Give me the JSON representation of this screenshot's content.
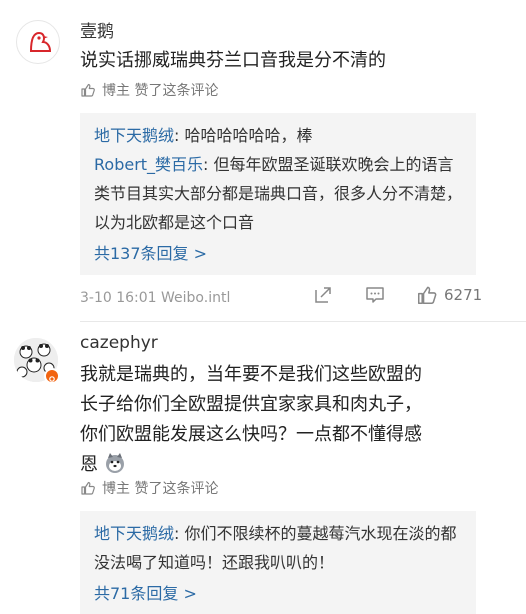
{
  "comments": [
    {
      "username": "壹鹅",
      "text": "说实话挪威瑞典芬兰口音我是分不清的",
      "liked_by": "博主 赞了这条评论",
      "replies": [
        {
          "name": "地下天鹅绒",
          "text": "哈哈哈哈哈哈，棒"
        },
        {
          "name": "Robert_樊百乐",
          "text": "但每年欧盟圣诞联欢晚会上的语言类节目其实大部分都是瑞典口音，很多人分不清楚，以为北欧都是这个口音"
        }
      ],
      "more_replies": "共137条回复 >",
      "meta": "3-10 16:01 Weibo.intl",
      "like_count": "6271"
    },
    {
      "username": "cazephyr",
      "text_lines": [
        "我就是瑞典的，当年要不是我们这些欧盟的",
        "长子给你们全欧盟提供宜家家具和肉丸子，",
        "你们欧盟能发展这么快吗？一点都不懂得感",
        "恩"
      ],
      "emoji": "husky-emoji",
      "liked_by": "博主 赞了这条评论",
      "replies": [
        {
          "name": "地下天鹅绒",
          "text": "你们不限续杯的蔓越莓汽水现在淡的都没法喝了知道吗！还跟我叭叭的！"
        }
      ],
      "more_replies": "共71条回复 >"
    }
  ],
  "colors": {
    "link": "#2b6aa5",
    "reply_bg": "#f4f4f4",
    "meta": "#999999"
  }
}
